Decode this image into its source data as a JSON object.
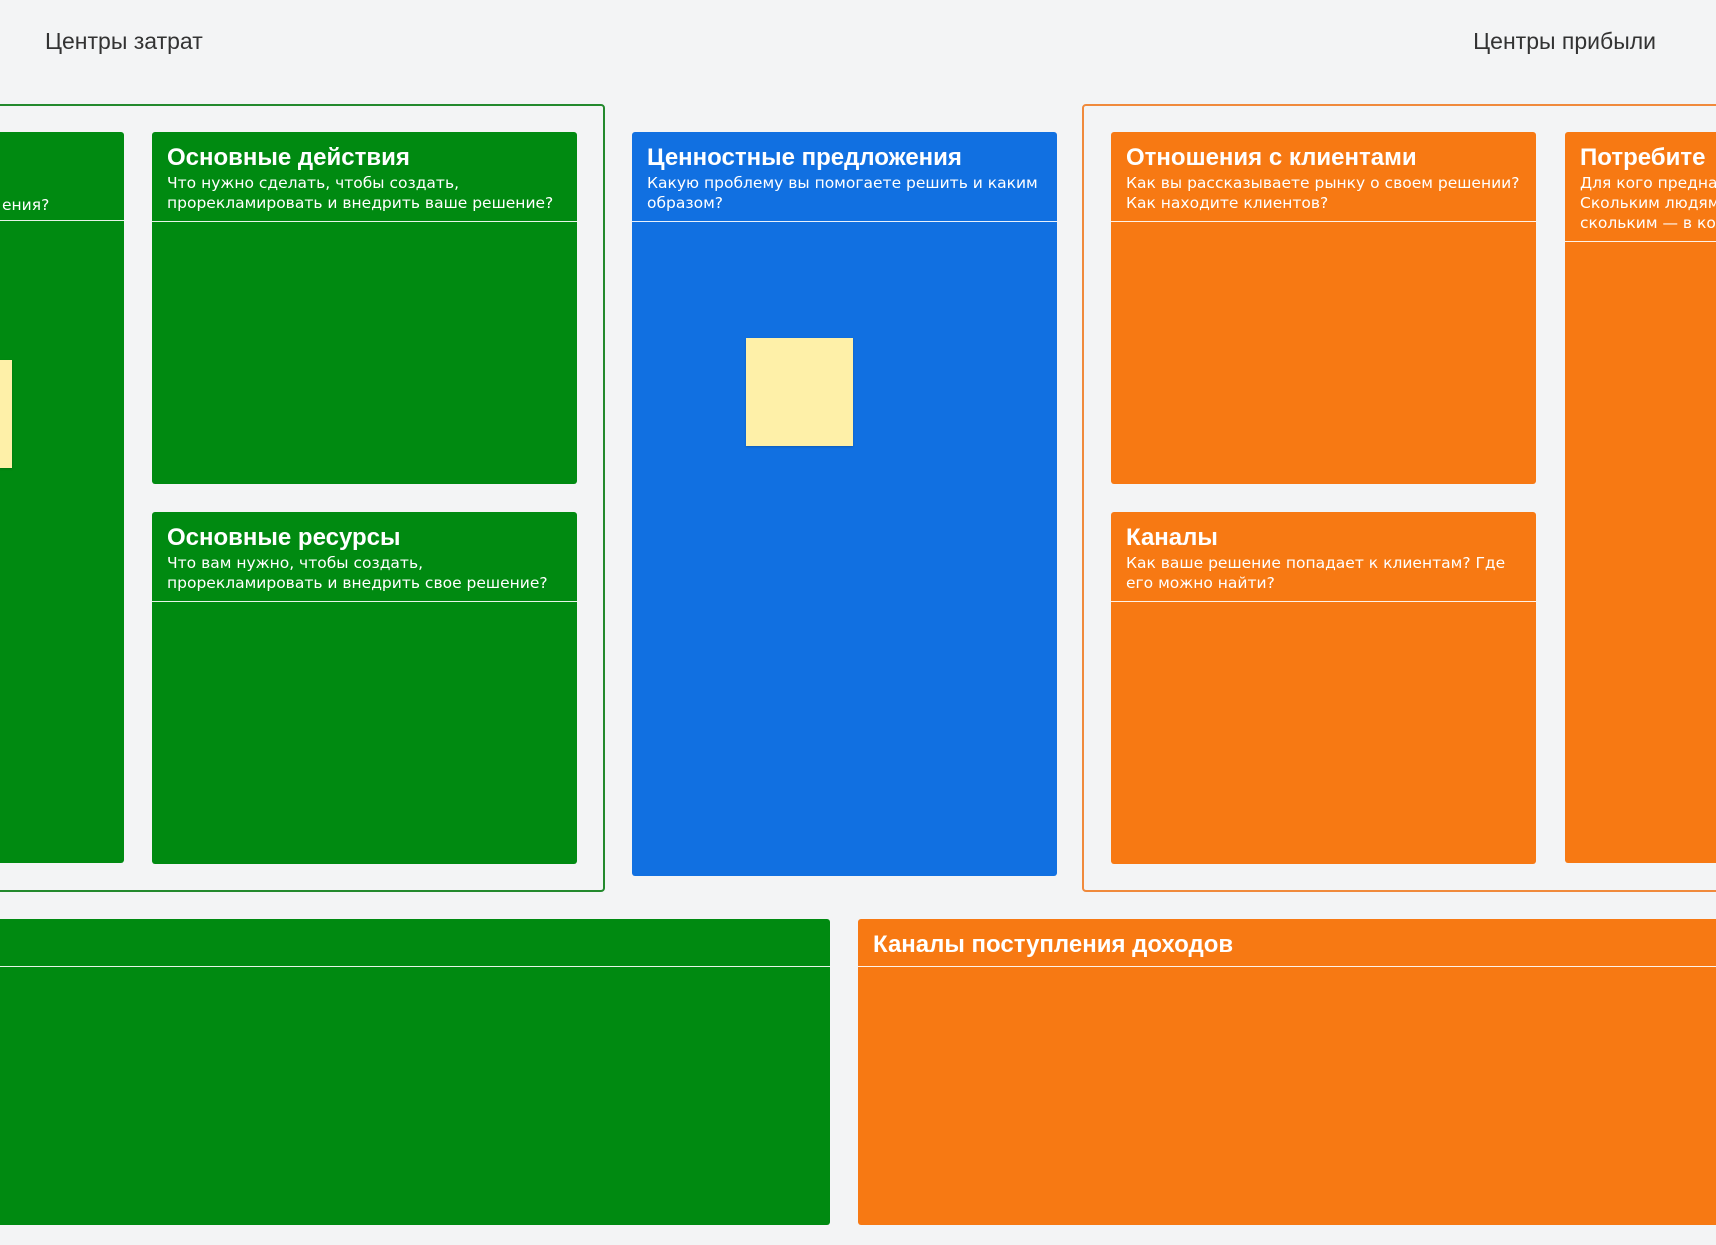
{
  "labels": {
    "cost_centers": "Центры затрат",
    "profit_centers": "Центры прибыли"
  },
  "colors": {
    "green": "#008a11",
    "blue": "#1170e1",
    "orange": "#f77913",
    "sticky": "#fef0a8",
    "background": "#f3f4f5"
  },
  "cards": {
    "partners": {
      "desc_tail": "ения?"
    },
    "key_activities": {
      "title": "Основные действия",
      "desc": "Что нужно сделать, чтобы создать, прорекламировать и внедрить ваше решение?"
    },
    "key_resources": {
      "title": "Основные ресурсы",
      "desc": "Что вам нужно, чтобы создать, прорекламировать и внедрить свое решение?"
    },
    "value_propositions": {
      "title": "Ценностные предложения",
      "desc": "Какую проблему вы помогаете решить и каким образом?"
    },
    "customer_relationships": {
      "title": "Отношения с клиентами",
      "desc": "Как вы рассказываете рынку о своем решении? Как находите клиентов?"
    },
    "channels": {
      "title": "Каналы",
      "desc": "Как ваше решение попадает к клиентам? Где его можно найти?"
    },
    "customer_segments": {
      "title": "Потребите",
      "desc_line1": "Для кого предна",
      "desc_line2": "Скольким людям",
      "desc_line3": "скольким — в ко"
    },
    "revenue_streams": {
      "title": "Каналы поступления доходов"
    }
  }
}
